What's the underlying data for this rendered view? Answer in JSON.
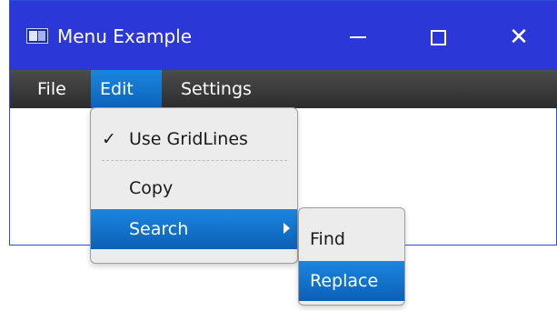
{
  "window": {
    "title": "Menu Example",
    "icon": "app-window-icon",
    "controls": {
      "minimize_icon": "minimize-icon",
      "maximize_icon": "maximize-icon",
      "close_icon": "close-icon",
      "close_glyph": "✕"
    },
    "titlebar_color": "#2b37d6"
  },
  "menubar": {
    "items": [
      {
        "label": "File"
      },
      {
        "label": "Edit",
        "active": true
      },
      {
        "label": "Settings"
      }
    ]
  },
  "edit_menu": {
    "items": [
      {
        "label": "Use GridLines",
        "checked": true,
        "check_glyph": "✓"
      },
      {
        "label": "Copy"
      },
      {
        "label": "Search",
        "has_submenu": true,
        "highlighted": true
      }
    ]
  },
  "search_submenu": {
    "items": [
      {
        "label": "Find"
      },
      {
        "label": "Replace",
        "highlighted": true
      }
    ]
  },
  "colors": {
    "accent": "#1577cf",
    "menubar": "#3a3a3a"
  }
}
